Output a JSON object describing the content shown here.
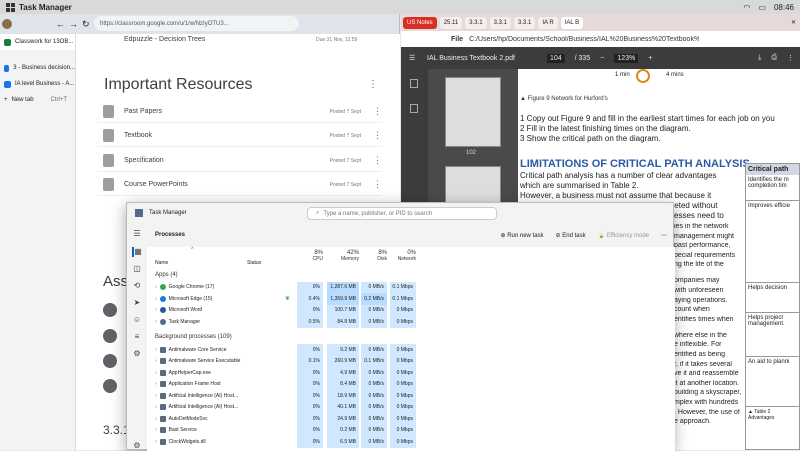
{
  "topbar": {
    "title": "Task Manager",
    "time": "08:46"
  },
  "chrome": {
    "url": "https://classroom.google.com/u/1/w/NzIyOTU3...",
    "vertical_tabs": [
      "Classwork for 13OB...",
      "3 - Business decision...",
      "IA level Business - A...",
      "New tab"
    ],
    "new_tab_shortcut": "Ctrl+T",
    "top_item": {
      "label": "Edpuzzle - Decision Trees",
      "date": "Due 31 Nov, 12:59"
    },
    "heading": "Important Resources",
    "resources": [
      {
        "label": "Past Papers",
        "date": "Posted 7 Sept"
      },
      {
        "label": "Textbook",
        "date": "Posted 7 Sept"
      },
      {
        "label": "Specification",
        "date": "Posted 7 Sept"
      },
      {
        "label": "Course PowerPoints",
        "date": "Posted 7 Sept"
      }
    ],
    "partial_heading": "Ass",
    "section_num": "3.3.1"
  },
  "pdf": {
    "tabs": [
      "US Notes",
      "25.11",
      "3.3.1",
      "3.3.1",
      "3.3.1",
      "IA R",
      "IAL B"
    ],
    "path": "C:/Users/hp/Documents/School/Business/IAL%20Business%20Textbook%202.pdf",
    "file_label": "File",
    "doc_title": "IAL Business Textbook 2.pdf",
    "page": "104",
    "page_total": "/ 335",
    "zoom": "123%",
    "thumb_label": "102",
    "diagram_min": "1 min",
    "diagram_mins": "4 mins",
    "figure_caption": "Figure 9 Network for Hurford's",
    "steps": [
      "Copy out Figure 9 and fill in the earliest start times for each job on you",
      "Fill in the latest finishing times on the diagram.",
      "Show the critical path on the diagram."
    ],
    "heading": "LIMITATIONS OF CRITICAL PATH ANALYSIS",
    "para_lines": [
      "Critical path analysis has a number of clear advantages",
      "which are summarised in Table 2.",
      "    However, a business must not assume that because it",
      "produces a network its project will be completed without",
      "delay. There are some limitations that businesses need to"
    ],
    "side_lines": [
      "ies in the network",
      "management might",
      "past performance,",
      "pecial requirements",
      "ng the life of the",
      "ompanies may",
      "with unforeseen",
      "aying operations.",
      "count when",
      "entifies times when",
      "where else in the",
      "e inflexible. For",
      "entified as being",
      "r, if it takes several",
      "ve it and reassemble",
      "it at another location.",
      "building a skyscraper,",
      "mplex with hundreds",
      ". However, the use of",
      "e approach."
    ],
    "table": {
      "header": "Critical path",
      "cells": [
        "Identifies the m completion tim",
        "Improves efficie",
        "Helps decision",
        "Helps project management.",
        "An aid to planni"
      ],
      "caption": "Table 2 Advantages"
    }
  },
  "taskmgr": {
    "title": "Task Manager",
    "search_placeholder": "Type a name, publisher, or PID to search",
    "page_title": "Processes",
    "run_new_task": "Run new task",
    "end_task": "End task",
    "efficiency": "Efficiency mode",
    "columns": {
      "name": "Name",
      "status": "Status",
      "cpu_pct": "8%",
      "cpu": "CPU",
      "mem_pct": "42%",
      "mem": "Memory",
      "disk_pct": "8%",
      "disk": "Disk",
      "net_pct": "0%",
      "net": "Network"
    },
    "apps_group": "Apps (4)",
    "apps": [
      {
        "name": "Google Chrome (17)",
        "cpu": "0%",
        "mem": "1,287.6 MB",
        "disk": "0 MB/s",
        "net": "0.1 Mbps",
        "color": "#34a853"
      },
      {
        "name": "Microsoft Edge (15)",
        "cpu": "0.4%",
        "mem": "1,359.9 MB",
        "disk": "0.2 MB/s",
        "net": "0.1 Mbps",
        "color": "#0a84d6"
      },
      {
        "name": "Microsoft Word",
        "cpu": "0%",
        "mem": "100.7 MB",
        "disk": "0 MB/s",
        "net": "0 Mbps",
        "color": "#2b579a"
      },
      {
        "name": "Task Manager",
        "cpu": "0.5%",
        "mem": "84.8 MB",
        "disk": "0 MB/s",
        "net": "0 Mbps",
        "color": "#4f6b8a"
      }
    ],
    "bg_group": "Background processes (109)",
    "bg": [
      {
        "name": "Antimalware Core Service",
        "cpu": "0%",
        "mem": "9.2 MB",
        "disk": "0 MB/s",
        "net": "0 Mbps"
      },
      {
        "name": "Antimalware Service Executable",
        "cpu": "0.1%",
        "mem": "260.9 MB",
        "disk": "0.1 MB/s",
        "net": "0 Mbps"
      },
      {
        "name": "AppHelperCap.exe",
        "cpu": "0%",
        "mem": "4.9 MB",
        "disk": "0 MB/s",
        "net": "0 Mbps"
      },
      {
        "name": "Application Frame Host",
        "cpu": "0%",
        "mem": "8.4 MB",
        "disk": "0 MB/s",
        "net": "0 Mbps"
      },
      {
        "name": "Artificial Intelligence (AI) Host...",
        "cpu": "0%",
        "mem": "18.9 MB",
        "disk": "0 MB/s",
        "net": "0 Mbps"
      },
      {
        "name": "Artificial Intelligence (AI) Host...",
        "cpu": "0%",
        "mem": "40.1 MB",
        "disk": "0 MB/s",
        "net": "0 Mbps"
      },
      {
        "name": "AutoDetModeSvc",
        "cpu": "0%",
        "mem": "24.9 MB",
        "disk": "0 MB/s",
        "net": "0 Mbps"
      },
      {
        "name": "Bast Service",
        "cpu": "0%",
        "mem": "0.2 MB",
        "disk": "0 MB/s",
        "net": "0 Mbps"
      },
      {
        "name": "ClockWidgets.dll",
        "cpu": "0%",
        "mem": "6.5 MB",
        "disk": "0 MB/s",
        "net": "0 Mbps"
      }
    ]
  }
}
